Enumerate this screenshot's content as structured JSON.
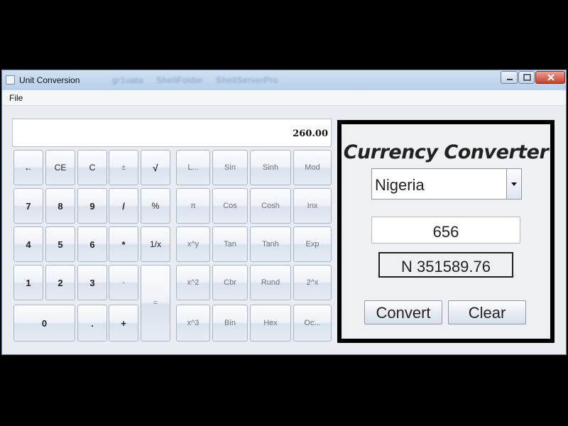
{
  "window": {
    "title": "Unit Conversion",
    "background_tabs": [
      "gr1uata",
      "ShellFolder",
      "ShellServerPro"
    ]
  },
  "menu": {
    "file": "File"
  },
  "calculator": {
    "display": "260.00",
    "keys": [
      [
        "←",
        "CE",
        "C",
        "±",
        "√"
      ],
      [
        "7",
        "8",
        "9",
        "/",
        "%"
      ],
      [
        "4",
        "5",
        "6",
        "*",
        "1/x"
      ],
      [
        "1",
        "2",
        "3",
        "-",
        "="
      ],
      [
        "0",
        ".",
        "+"
      ]
    ],
    "sci_keys": [
      [
        "L...",
        "Sin",
        "Sinh",
        "Mod"
      ],
      [
        "π",
        "Cos",
        "Cosh",
        "Inx"
      ],
      [
        "x^y",
        "Tan",
        "Tanh",
        "Exp"
      ],
      [
        "x^2",
        "Cbr",
        "Rund",
        "2^x"
      ],
      [
        "x^3",
        "Bin",
        "Hex",
        "Oc..."
      ]
    ]
  },
  "converter": {
    "title": "Currency Converter",
    "country": "Nigeria",
    "amount": "656",
    "result": "N 351589.76",
    "convert_label": "Convert",
    "clear_label": "Clear"
  },
  "colors": {
    "title_bar": "#c4d8ef",
    "close_button": "#c4412b",
    "panel_border": "#000000"
  }
}
